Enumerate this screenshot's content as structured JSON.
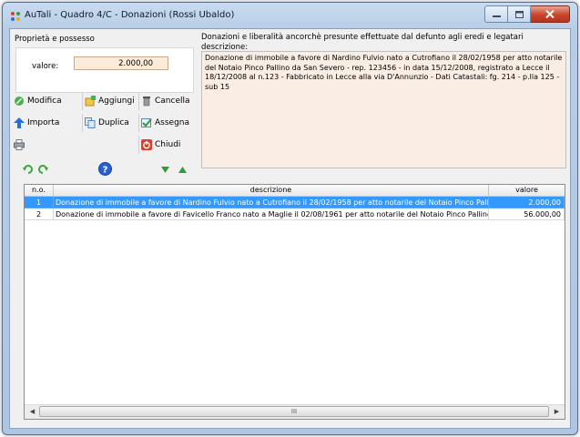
{
  "window": {
    "title": "AuTali - Quadro 4/C - Donazioni (Rossi Ubaldo)"
  },
  "left_panel": {
    "group_title": "Proprietà e possesso",
    "valore_label": "valore:",
    "valore_value": "2.000,00"
  },
  "right_panel": {
    "group_title": "Donazioni e liberalità ancorchè presunte effettuate dal defunto agli eredi e legatari",
    "descrizione_label": "descrizione:",
    "descrizione_text": "Donazione di immobile a favore di Nardino Fulvio nato a Cutrofiano il 28/02/1958 per atto notarile del Notaio Pinco Pallino da San Severo - rep. 123456 - in data 15/12/2008, registrato a Lecce il 18/12/2008 al n.123 - Fabbricato in Lecce alla via D'Annunzio - Dati Catastali: fg. 214 - p.lla 125 - sub 15"
  },
  "toolbar": {
    "modifica": "Modifica",
    "aggiungi": "Aggiungi",
    "cancella": "Cancella",
    "importa": "Importa",
    "duplica": "Duplica",
    "assegna": "Assegna",
    "chiudi": "Chiudi"
  },
  "grid": {
    "columns": [
      "n.o.",
      "descrizione",
      "valore"
    ],
    "rows": [
      {
        "n": "1",
        "descrizione": "Donazione di immobile a favore di Nardino Fulvio nato a Cutrofiano il 28/02/1958 per atto notarile del Notaio Pinco Pallino da S...",
        "valore": "2.000,00",
        "selected": true
      },
      {
        "n": "2",
        "descrizione": "Donazione di immobile a favore di Favicello Franco nato a Maglie il 02/08/1961 per atto notarile del Notaio Pinco Pallino da San...",
        "valore": "56.000,00",
        "selected": false
      }
    ],
    "scroll_grip": "III"
  },
  "icons": {
    "modifica": "edit-icon",
    "aggiungi": "add-icon",
    "cancella": "trash-icon",
    "importa": "import-arrow-icon",
    "duplica": "duplicate-icon",
    "assegna": "assign-icon",
    "print": "printer-icon",
    "chiudi": "close-icon",
    "help": "help-icon",
    "undo": "undo-icon",
    "redo": "redo-icon",
    "down": "move-down-icon",
    "up": "move-up-icon"
  },
  "colors": {
    "selection": "#3399ff",
    "input_bg": "#fdebd9",
    "desc_bg": "#faeee4"
  }
}
